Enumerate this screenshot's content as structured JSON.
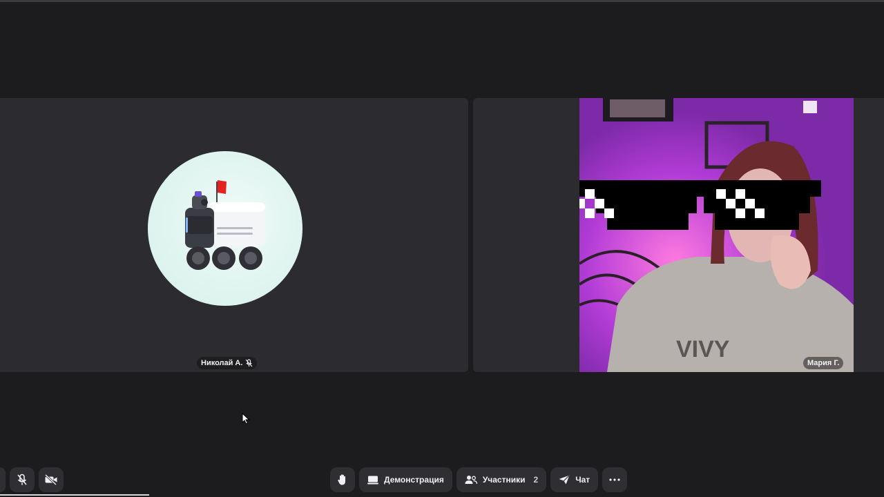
{
  "participants": [
    {
      "name": "Николай А.",
      "mic_muted": true,
      "camera_on": false,
      "avatar_icon": "delivery-robot-icon"
    },
    {
      "name": "Мария Г.",
      "mic_muted": false,
      "camera_on": true,
      "video_overlay_icon": "pixel-sunglasses-icon"
    }
  ],
  "toolbar": {
    "left_buttons": [
      "microphone-muted-icon",
      "camera-off-icon"
    ],
    "raise_hand_icon": "raised-hand-icon",
    "screen_share_label": "Демонстрация",
    "participants_label": "Участники",
    "participants_count": "2",
    "chat_label": "Чат",
    "more_icon": "more-dots-icon"
  },
  "colors": {
    "background": "#1c1c1e",
    "tile": "#2b2b30",
    "button": "#2e2e33",
    "avatar_bg": "#dcf3ee",
    "robot_flag": "#e52222"
  }
}
